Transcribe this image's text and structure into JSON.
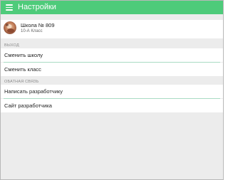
{
  "appbar": {
    "title": "Настройки",
    "menu_icon": "hamburger-menu-icon",
    "color": "#4ecb7a"
  },
  "school": {
    "name": "Школа № 809",
    "class_name": "10-А Класс",
    "avatar_icon": "school-avatar-icon"
  },
  "sections": {
    "exit": {
      "header": "ВЫХОД",
      "items": [
        "Сменить школу",
        "Сменить класс"
      ]
    },
    "feedback": {
      "header": "ОБАТНАЯ СВЯЗЬ",
      "items": [
        "Написать разработчику",
        "Сайт разработчика"
      ]
    }
  },
  "colors": {
    "background": "#ececec",
    "divider": "#a9dcc3",
    "text": "#222222",
    "section_header": "#8a8a8a"
  }
}
